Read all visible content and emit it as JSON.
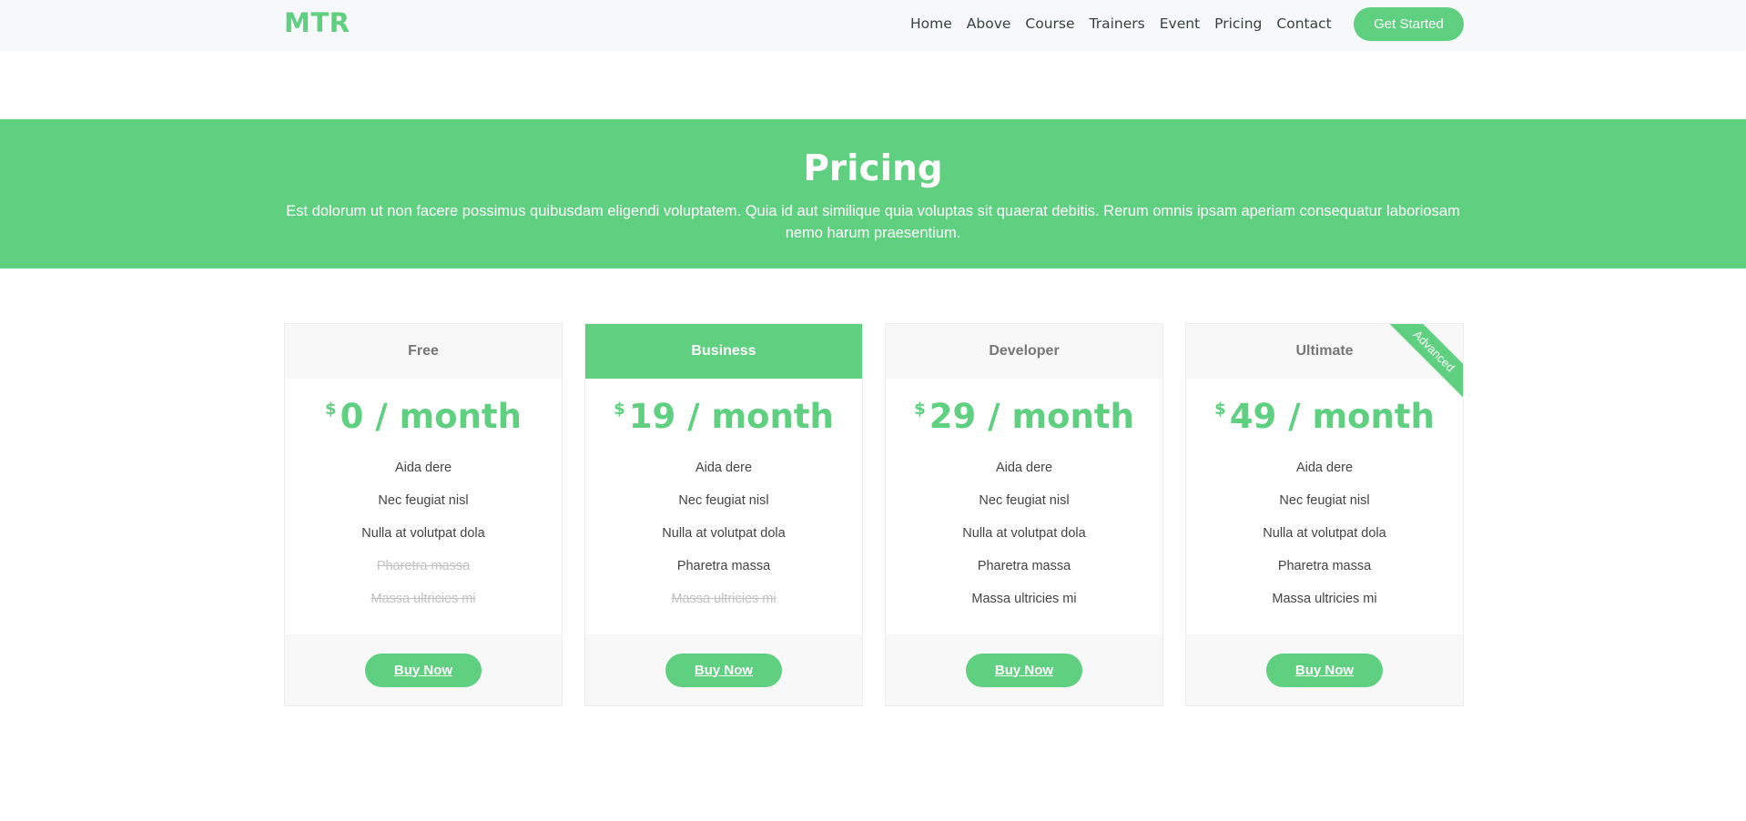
{
  "header": {
    "logo": "MTR",
    "nav": [
      "Home",
      "Above",
      "Course",
      "Trainers",
      "Event",
      "Pricing",
      "Contact"
    ],
    "cta": "Get Started"
  },
  "hero": {
    "title": "Pricing",
    "description": "Est dolorum ut non facere possimus quibusdam eligendi voluptatem. Quia id aut similique quia voluptas sit quaerat debitis. Rerum omnis ipsam aperiam consequatur laboriosam nemo harum praesentium."
  },
  "plans": [
    {
      "name": "Free",
      "currency": "$",
      "price": "0 / month",
      "features": [
        {
          "text": "Aida dere",
          "included": true
        },
        {
          "text": "Nec feugiat nisl",
          "included": true
        },
        {
          "text": "Nulla at volutpat dola",
          "included": true
        },
        {
          "text": "Pharetra massa",
          "included": false
        },
        {
          "text": "Massa ultricies mi",
          "included": false
        }
      ],
      "button": "Buy Now"
    },
    {
      "name": "Business",
      "currency": "$",
      "price": "19 / month",
      "featured": true,
      "features": [
        {
          "text": "Aida dere",
          "included": true
        },
        {
          "text": "Nec feugiat nisl",
          "included": true
        },
        {
          "text": "Nulla at volutpat dola",
          "included": true
        },
        {
          "text": "Pharetra massa",
          "included": true
        },
        {
          "text": "Massa ultricies mi",
          "included": false
        }
      ],
      "button": "Buy Now"
    },
    {
      "name": "Developer",
      "currency": "$",
      "price": "29 / month",
      "features": [
        {
          "text": "Aida dere",
          "included": true
        },
        {
          "text": "Nec feugiat nisl",
          "included": true
        },
        {
          "text": "Nulla at volutpat dola",
          "included": true
        },
        {
          "text": "Pharetra massa",
          "included": true
        },
        {
          "text": "Massa ultricies mi",
          "included": true
        }
      ],
      "button": "Buy Now"
    },
    {
      "name": "Ultimate",
      "currency": "$",
      "price": "49 / month",
      "ribbon": "Advanced",
      "features": [
        {
          "text": "Aida dere",
          "included": true
        },
        {
          "text": "Nec feugiat nisl",
          "included": true
        },
        {
          "text": "Nulla at volutpat dola",
          "included": true
        },
        {
          "text": "Pharetra massa",
          "included": true
        },
        {
          "text": "Massa ultricies mi",
          "included": true
        }
      ],
      "button": "Buy Now"
    }
  ],
  "colors": {
    "accent": "#5fcf80",
    "header_bg": "#f7f8fa",
    "card_head_bg": "#f8f8f8",
    "muted_text": "#c1c1c1"
  }
}
